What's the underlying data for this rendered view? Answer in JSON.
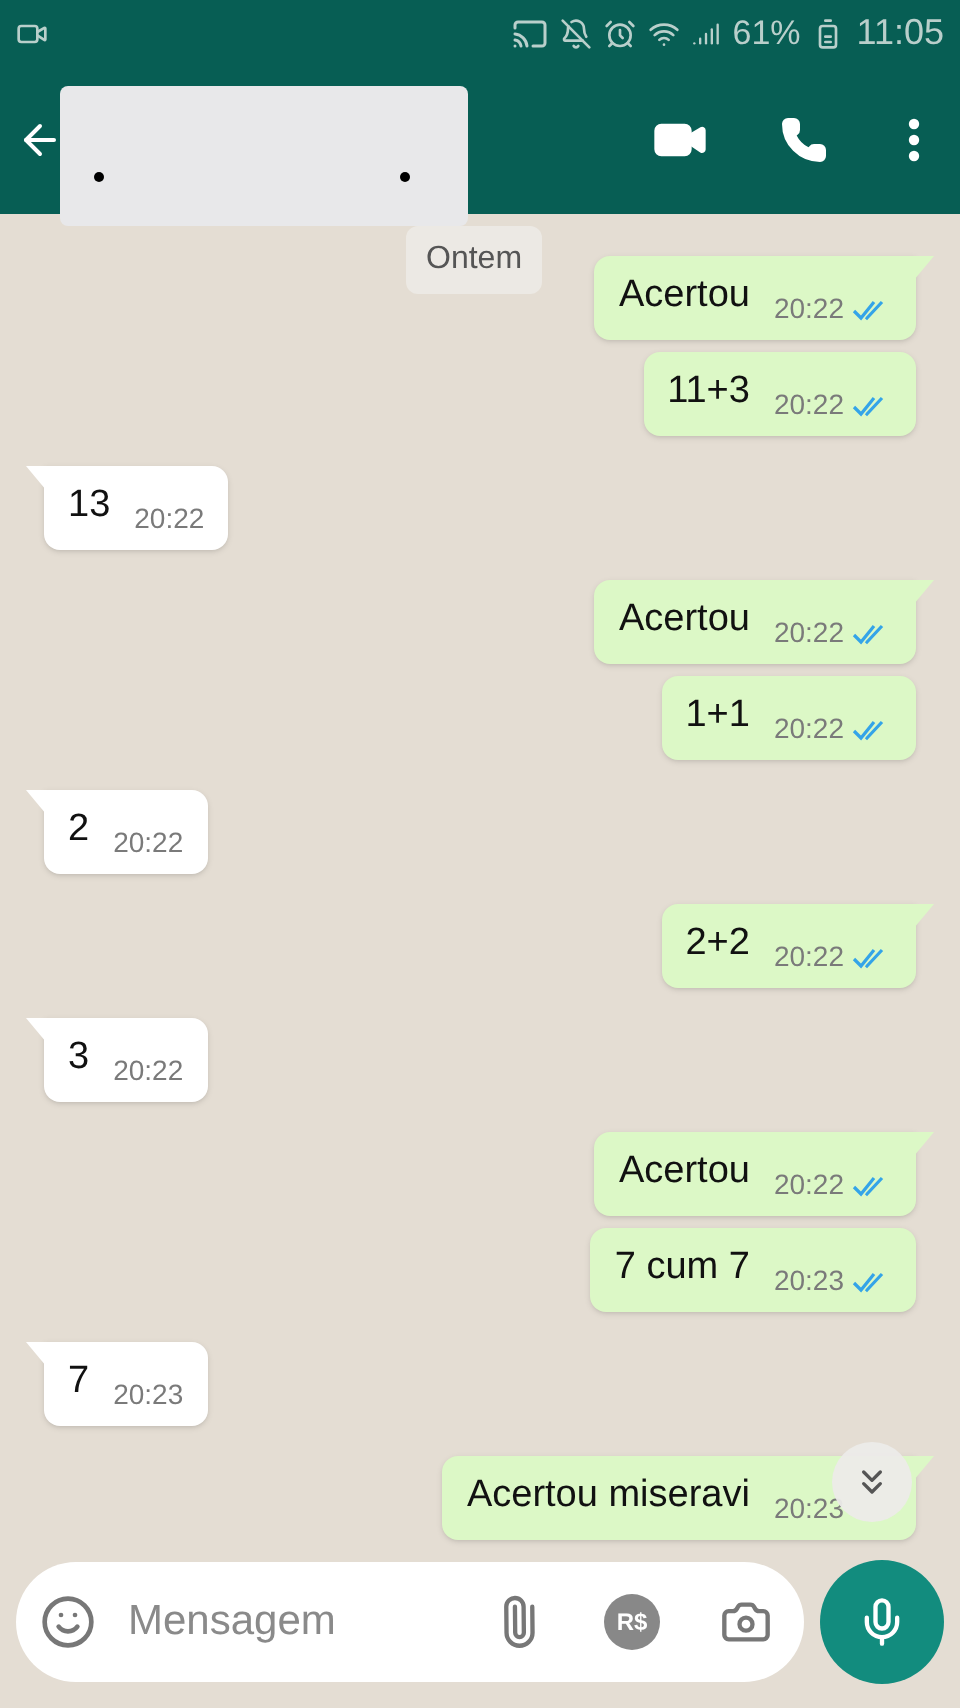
{
  "status_bar": {
    "battery": "61%",
    "time": "11:05"
  },
  "date_chip": "Ontem",
  "messages": [
    {
      "kind": "outgoing",
      "text": "Acertou",
      "time": "20:22",
      "read": true
    },
    {
      "kind": "outgoing",
      "text": "11+3",
      "time": "20:22",
      "read": true
    },
    {
      "kind": "incoming",
      "text": "13",
      "time": "20:22"
    },
    {
      "kind": "outgoing",
      "text": "Acertou",
      "time": "20:22",
      "read": true
    },
    {
      "kind": "outgoing",
      "text": "1+1",
      "time": "20:22",
      "read": true
    },
    {
      "kind": "incoming",
      "text": "2",
      "time": "20:22"
    },
    {
      "kind": "outgoing",
      "text": "2+2",
      "time": "20:22",
      "read": true
    },
    {
      "kind": "incoming",
      "text": "3",
      "time": "20:22"
    },
    {
      "kind": "outgoing",
      "text": "Acertou",
      "time": "20:22",
      "read": true
    },
    {
      "kind": "outgoing",
      "text": "7 cum 7",
      "time": "20:23",
      "read": true
    },
    {
      "kind": "incoming",
      "text": "7",
      "time": "20:23"
    },
    {
      "kind": "outgoing",
      "text": "Acertou miseravi",
      "time": "20:23"
    }
  ],
  "composer": {
    "placeholder": "Mensagem",
    "payment_label": "R$"
  }
}
